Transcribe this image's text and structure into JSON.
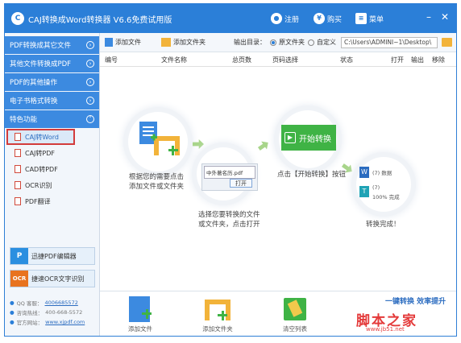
{
  "title_bar": {
    "logo_glyph": "C",
    "title": "CAJ转换成Word转换器 V6.6免费试用版",
    "register_label": "注册",
    "buy_label": "购买",
    "menu_label": "菜单",
    "buy_icon_glyph": "¥"
  },
  "sidebar": {
    "categories": [
      {
        "label": "PDF转换成其它文件"
      },
      {
        "label": "其他文件转换成PDF"
      },
      {
        "label": "PDF的其他操作"
      },
      {
        "label": "电子书格式转换"
      },
      {
        "label": "特色功能"
      }
    ],
    "sub_items": [
      {
        "label": "CAJ转Word",
        "active": true
      },
      {
        "label": "CAJ转PDF"
      },
      {
        "label": "CAD转PDF"
      },
      {
        "label": "OCR识别"
      },
      {
        "label": "PDF翻译"
      }
    ],
    "promos": [
      {
        "label": "迅捷PDF编辑器",
        "icon_glyph": "P",
        "color": "#2b8fe0"
      },
      {
        "label": "捷速OCR文字识别",
        "icon_glyph": "OCR",
        "color": "#e8731f"
      }
    ],
    "contact": {
      "qq_label": "QQ 客服：",
      "qq_value": "4006685572",
      "phone_label": "咨询热线：",
      "phone_value": "400-668-5572",
      "site_label": "官方网站：",
      "site_value": "www.xjpdf.com"
    }
  },
  "toolbar": {
    "add_file": "添加文件",
    "add_folder": "添加文件夹",
    "output_label": "输出目录：",
    "original_folder": "原文件夹",
    "custom": "自定义",
    "output_path": "C:\\Users\\ADMINI~1\\Desktop\\"
  },
  "table": {
    "headers": [
      "编号",
      "文件名称",
      "总页数",
      "页码选择",
      "状态",
      "打开",
      "输出",
      "移除"
    ]
  },
  "guide": {
    "step1_text": "根据您的需要点击\n添加文件或文件夹",
    "dialog_filename": "中外著名历.pdf",
    "dialog_open": "打开",
    "start_button": "开始转换",
    "step3_text": "点击【开始转换】按钮",
    "step2_text": "选择您要转换的文件\n或文件夹，点击打开",
    "progress_top": "(7)",
    "progress_top_label": "数据",
    "progress_bottom": "(7)",
    "progress_percent": "100%",
    "progress_done_label": "完成",
    "step4_text": "转换完成！"
  },
  "bottom": {
    "add_file": "添加文件",
    "add_folder": "添加文件夹",
    "clear_list": "清空列表",
    "slogan": "一键转换  效率提升",
    "watermark": "脚本之家",
    "watermark_url": "www.jb51.net"
  },
  "colors": {
    "accent": "#2b7fd8",
    "highlight": "#d33b3b",
    "watermark": "#e43a3a",
    "start_green": "#3fb345"
  }
}
